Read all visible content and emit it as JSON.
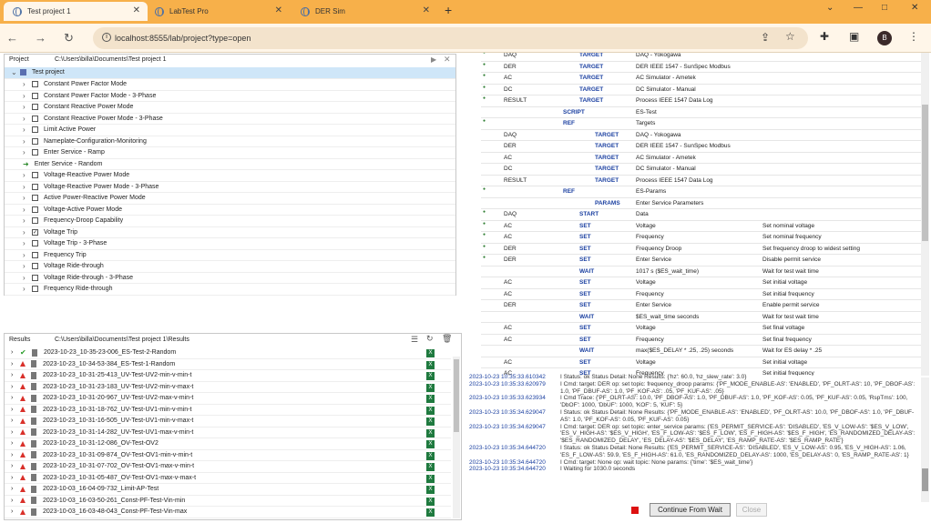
{
  "browser": {
    "tabs": [
      {
        "label": "Test project 1"
      },
      {
        "label": "LabTest Pro"
      },
      {
        "label": "DER Sim"
      }
    ],
    "url": "localhost:8555/lab/project?type=open",
    "profile_initial": "B"
  },
  "project": {
    "label": "Project",
    "path": "C:\\Users\\billa\\Documents\\Test project 1",
    "root": "Test project",
    "items": [
      {
        "label": "Constant Power Factor Mode",
        "checked": false
      },
      {
        "label": "Constant Power Factor Mode - 3-Phase",
        "checked": false
      },
      {
        "label": "Constant Reactive Power Mode",
        "checked": false
      },
      {
        "label": "Constant Reactive Power Mode - 3-Phase",
        "checked": false
      },
      {
        "label": "Limit Active Power",
        "checked": false
      },
      {
        "label": "Nameplate-Configuration-Monitoring",
        "checked": false
      },
      {
        "label": "Enter Service - Ramp",
        "checked": false
      },
      {
        "label": "Enter Service - Random",
        "checked": false
      },
      {
        "label": "Voltage-Reactive Power Mode",
        "checked": false
      },
      {
        "label": "Voltage-Reactive Power Mode - 3-Phase",
        "checked": false
      },
      {
        "label": "Active Power-Reactive Power Mode",
        "checked": false
      },
      {
        "label": "Voltage-Active Power Mode",
        "checked": false
      },
      {
        "label": "Frequency-Droop Capability",
        "checked": false
      },
      {
        "label": "Voltage Trip",
        "checked": true
      },
      {
        "label": "Voltage Trip - 3-Phase",
        "checked": false
      },
      {
        "label": "Frequency Trip",
        "checked": false
      },
      {
        "label": "Voltage Ride-through",
        "checked": false
      },
      {
        "label": "Voltage Ride-through - 3-Phase",
        "checked": false
      },
      {
        "label": "Frequency Ride-through",
        "checked": false
      }
    ]
  },
  "results": {
    "label": "Results",
    "path": "C:\\Users\\billa\\Documents\\Test project 1\\Results",
    "items": [
      {
        "label": "2023-10-23_10-35-23-006_ES-Test-2-Random",
        "status": "pass"
      },
      {
        "label": "2023-10-23_10-34-53-384_ES-Test-1-Random",
        "status": "fail"
      },
      {
        "label": "2023-10-23_10-31-25-413_UV-Test-UV2-min-v-min-t",
        "status": "fail"
      },
      {
        "label": "2023-10-23_10-31-23-183_UV-Test-UV2-min-v-max-t",
        "status": "fail"
      },
      {
        "label": "2023-10-23_10-31-20-967_UV-Test-UV2-max-v-min-t",
        "status": "fail"
      },
      {
        "label": "2023-10-23_10-31-18-762_UV-Test-UV1-min-v-min-t",
        "status": "fail"
      },
      {
        "label": "2023-10-23_10-31-16-505_UV-Test-UV1-min-v-max-t",
        "status": "fail"
      },
      {
        "label": "2023-10-23_10-31-14-282_UV-Test-UV1-max-v-min-t",
        "status": "fail"
      },
      {
        "label": "2023-10-23_10-31-12-086_OV-Test-OV2",
        "status": "fail"
      },
      {
        "label": "2023-10-23_10-31-09-874_OV-Test-OV1-min-v-min-t",
        "status": "fail"
      },
      {
        "label": "2023-10-23_10-31-07-702_OV-Test-OV1-max-v-min-t",
        "status": "fail"
      },
      {
        "label": "2023-10-23_10-31-05-487_OV-Test-OV1-max-v-max-t",
        "status": "fail"
      },
      {
        "label": "2023-10-03_16-04-09-732_Limit-AP-Test",
        "status": "fail"
      },
      {
        "label": "2023-10-03_16-03-50-261_Const-PF-Test-Vin-min",
        "status": "fail"
      },
      {
        "label": "2023-10-03_16-03-48-043_Const-PF-Test-Vin-max",
        "status": "fail"
      }
    ]
  },
  "script": {
    "rows": [
      {
        "b": true,
        "c1": "DAQ",
        "k": "TARGET",
        "ki": 1,
        "c3": "DAQ - Yokogawa",
        "c4": ""
      },
      {
        "b": true,
        "c1": "DER",
        "k": "TARGET",
        "ki": 1,
        "c3": "DER IEEE 1547 - SunSpec Modbus",
        "c4": ""
      },
      {
        "b": true,
        "c1": "AC",
        "k": "TARGET",
        "ki": 1,
        "c3": "AC Simulator - Ametek",
        "c4": ""
      },
      {
        "b": true,
        "c1": "DC",
        "k": "TARGET",
        "ki": 1,
        "c3": "DC Simulator - Manual",
        "c4": ""
      },
      {
        "b": true,
        "c1": "RESULT",
        "k": "TARGET",
        "ki": 1,
        "c3": "Process IEEE 1547 Data Log",
        "c4": ""
      },
      {
        "b": false,
        "c1": "",
        "k": "SCRIPT",
        "ki": 0,
        "c3": "ES-Test",
        "c4": ""
      },
      {
        "b": true,
        "c1": "",
        "k": "REF",
        "ki": 0,
        "c3": "Targets",
        "c4": ""
      },
      {
        "b": false,
        "c1": "DAQ",
        "k": "TARGET",
        "ki": 2,
        "c3": "DAQ - Yokogawa",
        "c4": ""
      },
      {
        "b": false,
        "c1": "DER",
        "k": "TARGET",
        "ki": 2,
        "c3": "DER IEEE 1547 - SunSpec Modbus",
        "c4": ""
      },
      {
        "b": false,
        "c1": "AC",
        "k": "TARGET",
        "ki": 2,
        "c3": "AC Simulator - Ametek",
        "c4": ""
      },
      {
        "b": false,
        "c1": "DC",
        "k": "TARGET",
        "ki": 2,
        "c3": "DC Simulator - Manual",
        "c4": ""
      },
      {
        "b": false,
        "c1": "RESULT",
        "k": "TARGET",
        "ki": 2,
        "c3": "Process IEEE 1547 Data Log",
        "c4": ""
      },
      {
        "b": true,
        "c1": "",
        "k": "REF",
        "ki": 0,
        "c3": "ES-Params",
        "c4": ""
      },
      {
        "b": false,
        "c1": "",
        "k": "PARAMS",
        "ki": 2,
        "c3": "Enter Service Parameters",
        "c4": ""
      },
      {
        "b": true,
        "c1": "DAQ",
        "k": "START",
        "ki": 1,
        "c3": "Data",
        "c4": ""
      },
      {
        "b": true,
        "c1": "AC",
        "k": "SET",
        "ki": 1,
        "c3": "Voltage",
        "c4": "Set nominal voltage"
      },
      {
        "b": true,
        "c1": "AC",
        "k": "SET",
        "ki": 1,
        "c3": "Frequency",
        "c4": "Set nominal frequency"
      },
      {
        "b": true,
        "c1": "DER",
        "k": "SET",
        "ki": 1,
        "c3": "Frequency Droop",
        "c4": "Set frequency droop to widest setting"
      },
      {
        "b": true,
        "c1": "DER",
        "k": "SET",
        "ki": 1,
        "c3": "Enter Service",
        "c4": "Disable permit service"
      },
      {
        "b": false,
        "c1": "",
        "k": "WAIT",
        "ki": 1,
        "c3": "1017 s ($ES_wait_time)",
        "c4": "Wait for test wait time"
      },
      {
        "b": false,
        "c1": "AC",
        "k": "SET",
        "ki": 1,
        "c3": "Voltage",
        "c4": "Set initial voltage"
      },
      {
        "b": false,
        "c1": "AC",
        "k": "SET",
        "ki": 1,
        "c3": "Frequency",
        "c4": "Set initial frequency"
      },
      {
        "b": false,
        "c1": "DER",
        "k": "SET",
        "ki": 1,
        "c3": "Enter Service",
        "c4": "Enable permit service"
      },
      {
        "b": false,
        "c1": "",
        "k": "WAIT",
        "ki": 1,
        "c3": "$ES_wait_time seconds",
        "c4": "Wait for test wait time"
      },
      {
        "b": false,
        "c1": "AC",
        "k": "SET",
        "ki": 1,
        "c3": "Voltage",
        "c4": "Set final voltage"
      },
      {
        "b": false,
        "c1": "AC",
        "k": "SET",
        "ki": 1,
        "c3": "Frequency",
        "c4": "Set final frequency"
      },
      {
        "b": false,
        "c1": "",
        "k": "WAIT",
        "ki": 1,
        "c3": "max($ES_DELAY * .25, .25) seconds",
        "c4": "Wait for ES delay * .25"
      },
      {
        "b": false,
        "c1": "AC",
        "k": "SET",
        "ki": 1,
        "c3": "Voltage",
        "c4": "Set initial voltage"
      },
      {
        "b": false,
        "c1": "AC",
        "k": "SET",
        "ki": 1,
        "c3": "Frequency",
        "c4": "Set initial frequency"
      }
    ]
  },
  "log": [
    {
      "ts": "2023-10-23 10:35:33.610342",
      "msg": "I   Status: ok Status Detail: None Results: {'hz': 60.0, 'hz_slew_rate': 3.0}"
    },
    {
      "ts": "2023-10-23 10:35:33.620979",
      "msg": "I   Cmd: target: DER op: set topic: frequency_droop params: {'PF_MODE_ENABLE-AS': 'ENABLED', 'PF_OLRT-AS': 10, 'PF_DBOF-AS': 1.0, 'PF_DBUF-AS': 1.0, 'PF_KOF-AS': .05, 'PF_KUF-AS': .05}"
    },
    {
      "ts": "2023-10-23 10:35:33.623934",
      "msg": "I   Cmd Trace: {'PF_OLRT-AS': 10.0, 'PF_DBOF-AS': 1.0, 'PF_DBUF-AS': 1.0, 'PF_KOF-AS': 0.05, 'PF_KUF-AS': 0.05, 'RspTms': 100, 'DbOF': 1000, 'DbUF': 1000, 'KOF': 5, 'KUF': 5}"
    },
    {
      "ts": "2023-10-23 10:35:34.629047",
      "msg": "I   Status: ok Status Detail: None Results: {'PF_MODE_ENABLE-AS': 'ENABLED', 'PF_OLRT-AS': 10.0, 'PF_DBOF-AS': 1.0, 'PF_DBUF-AS': 1.0, 'PF_KOF-AS': 0.05, 'PF_KUF-AS': 0.05}"
    },
    {
      "ts": "2023-10-23 10:35:34.629047",
      "msg": "I   Cmd: target: DER op: set topic: enter_service params: {'ES_PERMIT_SERVICE-AS': 'DISABLED', 'ES_V_LOW-AS': '$ES_V_LOW', 'ES_V_HIGH-AS': '$ES_V_HIGH', 'ES_F_LOW-AS': '$ES_F_LOW', 'ES_F_HIGH-AS': '$ES_F_HIGH', 'ES_RANDOMIZED_DELAY-AS': '$ES_RANDOMIZED_DELAY', 'ES_DELAY-AS': '$ES_DELAY', 'ES_RAMP_RATE-AS': '$ES_RAMP_RATE'}"
    },
    {
      "ts": "2023-10-23 10:35:34.644720",
      "msg": "I   Status: ok Status Detail: None Results: {'ES_PERMIT_SERVICE-AS': 'DISABLED', 'ES_V_LOW-AS': 0.95, 'ES_V_HIGH-AS': 1.06, 'ES_F_LOW-AS': 59.9, 'ES_F_HIGH-AS': 61.0, 'ES_RANDOMIZED_DELAY-AS': 1000, 'ES_DELAY-AS': 0, 'ES_RAMP_RATE-AS': 1}"
    },
    {
      "ts": "2023-10-23 10:35:34.644720",
      "msg": "I   Cmd: target: None op: wait topic: None params: {'time': '$ES_wait_time'}"
    },
    {
      "ts": "2023-10-23 10:35:34.644720",
      "msg": "I   Waiting for 1030.0 seconds"
    }
  ],
  "buttons": {
    "continue": "Continue From Wait",
    "close": "Close"
  }
}
